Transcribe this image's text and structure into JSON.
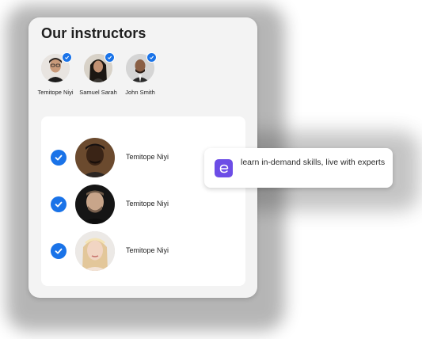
{
  "card": {
    "title": "Our instructors",
    "top_instructors": [
      {
        "name": "Temitope Niyi",
        "verified": true
      },
      {
        "name": "Samuel Sarah",
        "verified": true
      },
      {
        "name": "John Smith",
        "verified": true
      }
    ],
    "list": [
      {
        "name": "Temitope Niyi",
        "checked": true
      },
      {
        "name": "Temitope Niyi",
        "checked": true
      },
      {
        "name": "Temitope Niyi",
        "checked": true
      }
    ]
  },
  "toast": {
    "icon": "brand-logo-icon",
    "text": "learn in-demand skills, live with experts"
  },
  "colors": {
    "accent_blue": "#1a73e8",
    "brand_purple": "#6c4de6",
    "card_bg": "#f3f3f3"
  }
}
